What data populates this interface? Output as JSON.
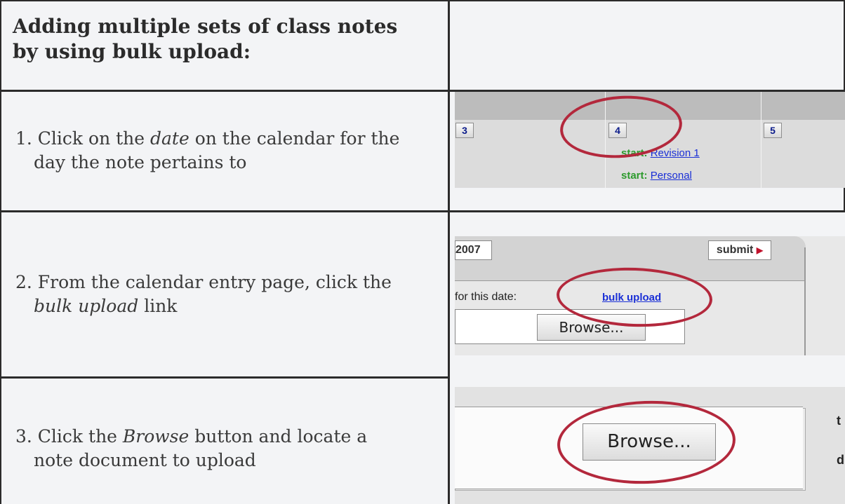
{
  "header": {
    "title_line1": "Adding multiple sets of class notes",
    "title_line2": "by using bulk upload:"
  },
  "steps": [
    {
      "prefix": "1. Click on the ",
      "em": "date",
      "suffix": " on the calendar for the",
      "line2": "day the note pertains to"
    },
    {
      "prefix": "2. From the calendar entry page, click the",
      "em": "bulk upload",
      "suffix": " link"
    },
    {
      "prefix": "3. Click the ",
      "em": "Browse",
      "suffix": " button and locate a",
      "line2": "note document to upload"
    }
  ],
  "shot1": {
    "days": [
      "3",
      "4",
      "5"
    ],
    "start_label": "start:",
    "events": [
      "Revision 1",
      "Personal"
    ]
  },
  "shot2": {
    "year": "2007",
    "submit_label": "submit",
    "date_label": "for this date:",
    "bulk_link": "bulk upload",
    "browse_label": "Browse..."
  },
  "shot3": {
    "browse_label": "Browse...",
    "edge_chars": [
      "t",
      "d"
    ]
  },
  "colors": {
    "ring": "#b3283c",
    "link": "#1a2fd6",
    "start": "#2c9a2c",
    "background": "#f3f4f6"
  }
}
